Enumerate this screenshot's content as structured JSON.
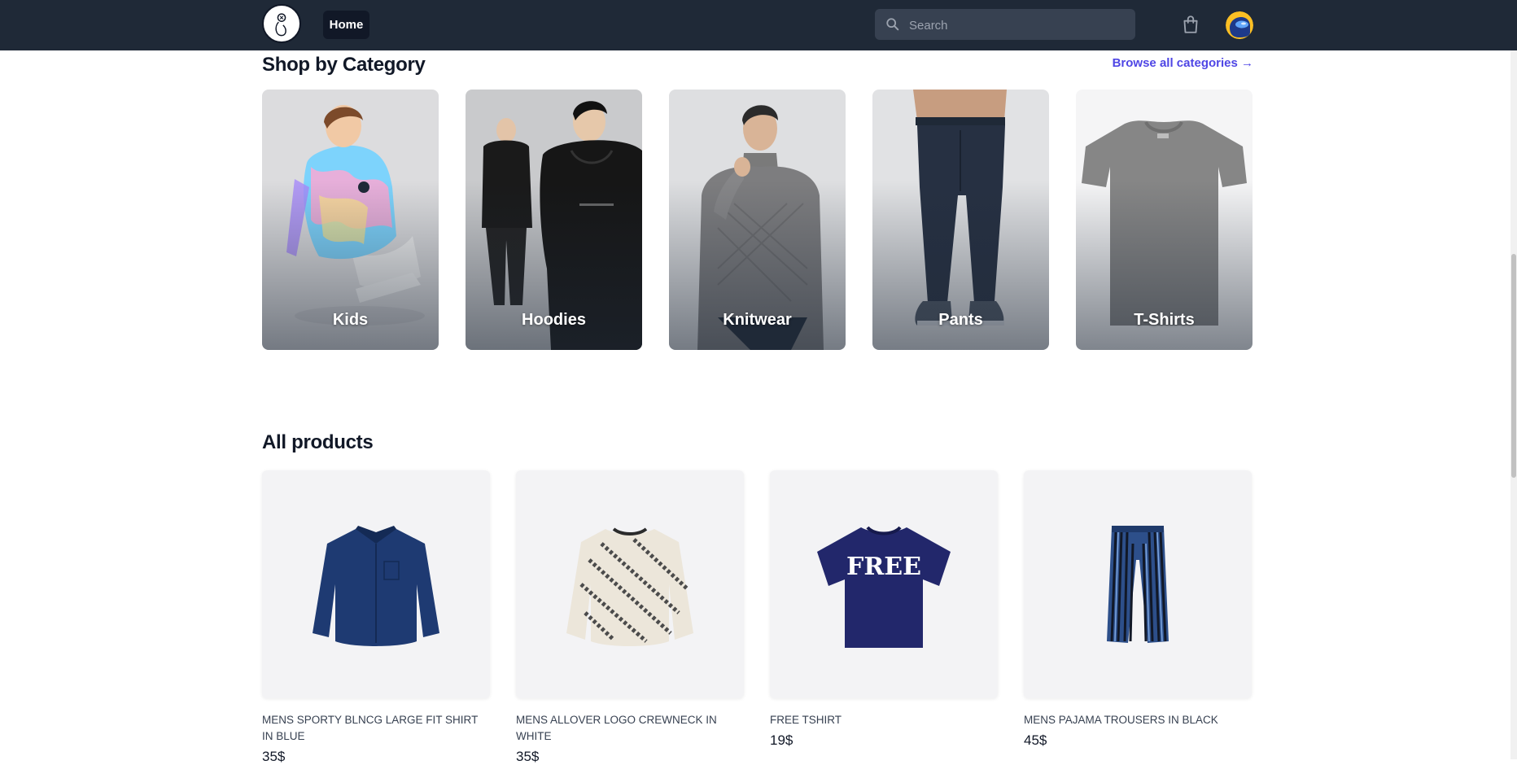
{
  "nav": {
    "home_label": "Home",
    "search_placeholder": "Search",
    "logo_icon": "logo-icon",
    "cart_icon": "shopping-bag-icon",
    "avatar_icon": "avatar-icon"
  },
  "categories_section": {
    "title": "Shop by Category",
    "browse_label": "Browse all categories →",
    "items": [
      {
        "label": "Kids"
      },
      {
        "label": "Hoodies"
      },
      {
        "label": "Knitwear"
      },
      {
        "label": "Pants"
      },
      {
        "label": "T-Shirts"
      }
    ]
  },
  "products_section": {
    "title": "All products",
    "items": [
      {
        "name": "MENS SPORTY BLNCG LARGE FIT SHIRT IN BLUE",
        "price": "35$",
        "image_icon": "shirt-icon"
      },
      {
        "name": "MENS ALLOVER LOGO CREWNECK IN WHITE",
        "price": "35$",
        "image_icon": "sweater-icon"
      },
      {
        "name": "FREE TSHIRT",
        "price": "19$",
        "image_icon": "tshirt-icon",
        "print_text": "FREE"
      },
      {
        "name": "MENS PAJAMA TROUSERS IN BLACK",
        "price": "45$",
        "image_icon": "trousers-icon"
      }
    ]
  },
  "colors": {
    "nav_bg": "#1f2937",
    "accent": "#4f46e5",
    "card_bg": "#f3f3f5"
  }
}
